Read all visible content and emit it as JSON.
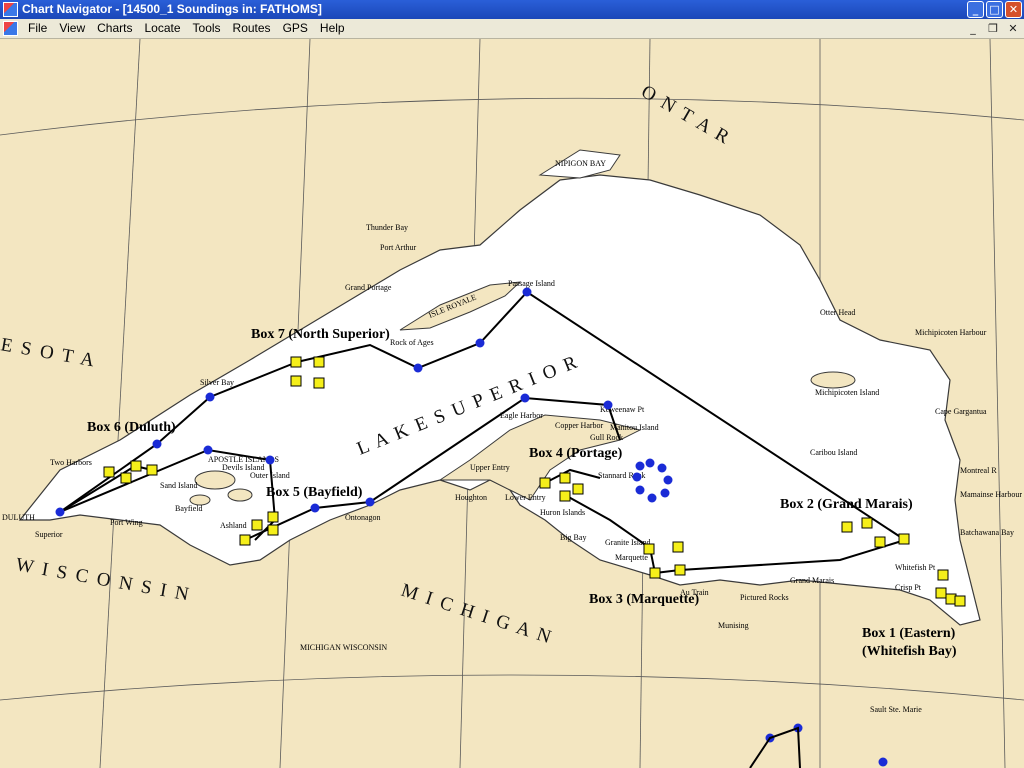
{
  "window": {
    "title": "Chart Navigator - [14500_1 Soundings in: FATHOMS]",
    "minimize_glyph": "_",
    "maximize_glyph": "□",
    "close_glyph": "✕",
    "mdi_minimize_glyph": "_",
    "mdi_restore_glyph": "❐",
    "mdi_close_glyph": "✕"
  },
  "menu": [
    "File",
    "View",
    "Charts",
    "Locate",
    "Tools",
    "Routes",
    "GPS",
    "Help"
  ],
  "map": {
    "water_color": "#ffffff",
    "land_color": "#f3e6c1",
    "route_color": "#000000",
    "waypoint_color": "#1a2bd6",
    "box_marker_color": "#f5ef1a",
    "region_labels": {
      "lake": "L A K E   S U P E R I O R",
      "ontario": "O N T A R",
      "michigan": "M I C H I G A N",
      "wisconsin": "W I S C O N S I N",
      "minnesota": "E S O T A"
    },
    "box_labels": {
      "box1_line1": "Box 1 (Eastern)",
      "box1_line2": "(Whitefish Bay)",
      "box2": "Box 2 (Grand Marais)",
      "box3": "Box 3 (Marquette)",
      "box4": "Box 4 (Portage)",
      "box5": "Box 5 (Bayfield)",
      "box6": "Box 6 (Duluth)",
      "box7": "Box 7 (North Superior)"
    },
    "place_labels": {
      "thunder_bay": "Thunder Bay",
      "nipigon_bay": "NIPIGON BAY",
      "michipicoten": "Michipicoten Harbour",
      "otter_head": "Otter Head",
      "cape_gargantua": "Cape Gargantua",
      "duluth": "DULUTH",
      "superior": "Superior",
      "two_harbors": "Two Harbors",
      "bayfield": "Bayfield",
      "ashland": "Ashland",
      "ontonagon": "Ontonagon",
      "houghton": "Houghton",
      "marquette": "Marquette",
      "munising": "Munising",
      "grand_marais": "Grand Marais",
      "whitefish_point": "Whitefish Pt",
      "sault": "Sault Ste. Marie",
      "michigan_wisconsin": "MICHIGAN WISCONSIN",
      "isle_royale": "ISLE ROYALE",
      "apostle_islands": "APOSTLE ISLANDS",
      "keweenaw": "Keweenaw Pt",
      "eagle_harbor": "Eagle Harbor",
      "port_wing": "Port Wing",
      "grand_portage": "Grand Portage",
      "silver_bay": "Silver Bay",
      "michipicoten_island": "Michipicoten Island",
      "caribou_island": "Caribou Island",
      "manitou_island": "Manitou Island",
      "stannard_rock": "Stannard Rock",
      "granite_island": "Granite Island",
      "huron_islands": "Huron Islands",
      "big_bay": "Big Bay",
      "au_train": "Au Train",
      "pictured_rocks": "Pictured Rocks",
      "crisp_point": "Crisp Pt",
      "mamainse": "Mamainse Harbour",
      "batchawana": "Batchawana Bay",
      "montreal_river": "Montreal R",
      "port_arthur": "Port Arthur",
      "passage_island": "Passage Island",
      "rock_of_ages": "Rock of Ages",
      "sand_island": "Sand Island",
      "outer_island": "Outer Island",
      "devils_island": "Devils Island",
      "copper_harbor": "Copper Harbor",
      "gull_rock": "Gull Rock",
      "upper_entry": "Upper Entry",
      "lower_entry": "Lower Entry"
    }
  }
}
